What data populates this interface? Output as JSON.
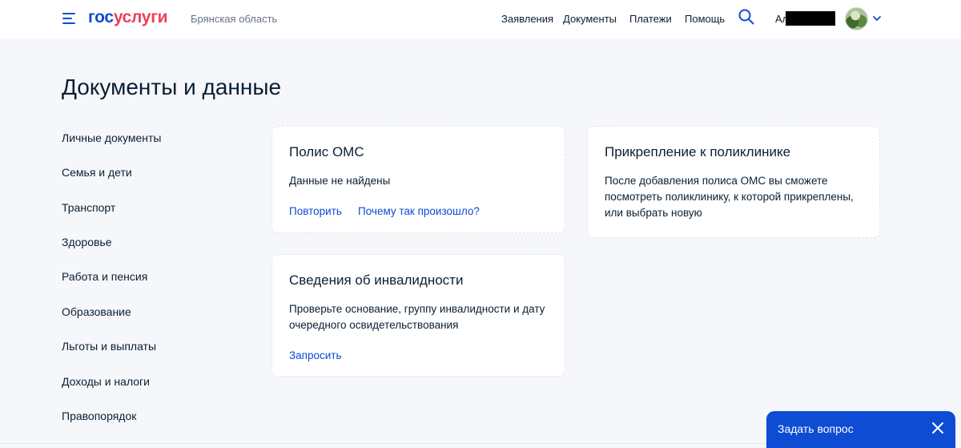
{
  "header": {
    "logo_part1": "гос",
    "logo_part2": "услуги",
    "region": "Брянская область",
    "nav": [
      "Заявления",
      "Документы",
      "Платежи",
      "Помощь"
    ],
    "user_initial": "Ал",
    "icons": {
      "menu": "burger-menu-icon",
      "search": "search-icon",
      "chevron": "chevron-down-icon"
    }
  },
  "main": {
    "title": "Документы и данные"
  },
  "sidebar": {
    "items": [
      {
        "label": "Личные документы"
      },
      {
        "label": "Семья и дети"
      },
      {
        "label": "Транспорт"
      },
      {
        "label": "Здоровье"
      },
      {
        "label": "Работа и пенсия"
      },
      {
        "label": "Образование"
      },
      {
        "label": "Льготы и выплаты"
      },
      {
        "label": "Доходы и налоги"
      },
      {
        "label": "Правопорядок"
      }
    ]
  },
  "cards": {
    "oms": {
      "title": "Полис ОМС",
      "status": "Данные не найдены",
      "retry": "Повторить",
      "why": "Почему так произошло?"
    },
    "disability": {
      "title": "Сведения об инвалидности",
      "text_line1": "Проверьте основание, группу инвалидности и дату",
      "text_line2": "очередного освидетельствования",
      "request": "Запросить"
    },
    "clinic": {
      "title": "Прикрепление к поликлинике",
      "text_line1": "После добавления полиса ОМС вы сможете",
      "text_line2": "посмотреть поликлинику, к которой прикреплены,",
      "text_line3": "или выбрать новую"
    }
  },
  "chat": {
    "label": "Задать вопрос",
    "close_icon": "close-icon"
  },
  "colors": {
    "brand_blue": "#0d4cd3",
    "brand_red": "#ee3f58",
    "page_bg": "#f5f7fa",
    "text": "#0b1f33",
    "muted": "#66727f"
  }
}
